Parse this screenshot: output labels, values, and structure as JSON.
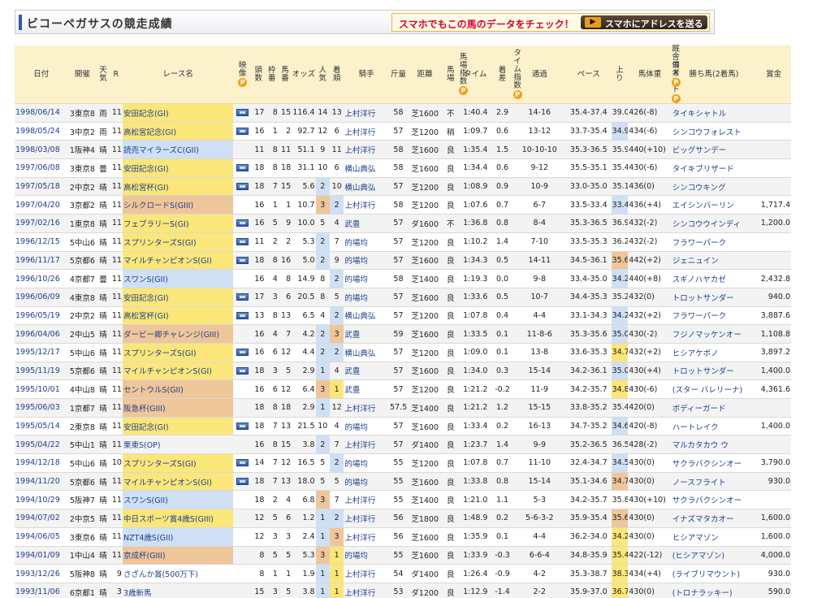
{
  "header": {
    "title": "ビコーペガサスの競走成績",
    "promo_text": "スマホでもこの馬のデータをチェック！",
    "promo_button": "スマホにアドレスを送る",
    "promo_icon_text": "▶"
  },
  "columns": [
    "日付",
    "開催",
    "天気",
    "R",
    "レース名",
    "映像",
    "頭数",
    "枠番",
    "馬番",
    "オッズ",
    "人気",
    "着順",
    "騎手",
    "斤量",
    "距離",
    "馬場",
    "馬場指数",
    "タイム",
    "着差",
    "タイム指数",
    "通過",
    "ペース",
    "上り",
    "馬体重",
    "厩舎コメント",
    "備考",
    "勝ち馬(2着馬)",
    "賞金"
  ],
  "rows": [
    {
      "date": "1998/06/14",
      "venue": "3東京8",
      "weather": "雨",
      "r": "11",
      "race": "安田記念(GI)",
      "race_color": "y",
      "video": true,
      "heads": "17",
      "waku": "8",
      "umaban": "15",
      "odds": "116.4",
      "ninki": "14",
      "rank": "13",
      "jockey": "上村洋行",
      "kin": "58",
      "dist": "芝1600",
      "baba": "不",
      "time": "1:40.4",
      "diff": "2.9",
      "pass": "14-16",
      "pace": "35.4-37.4",
      "agari": "39.0",
      "agari_hl": "",
      "weight": "426(-8)",
      "winner": "タイキシャトル",
      "prize": ""
    },
    {
      "date": "1998/05/24",
      "venue": "3中京2",
      "weather": "雨",
      "r": "11",
      "race": "高松宮記念(GI)",
      "race_color": "y",
      "video": true,
      "heads": "16",
      "waku": "1",
      "umaban": "2",
      "odds": "92.7",
      "ninki": "12",
      "rank": "6",
      "jockey": "上村洋行",
      "kin": "57",
      "dist": "芝1200",
      "baba": "稍",
      "time": "1:09.7",
      "diff": "0.6",
      "pass": "13-12",
      "pace": "33.7-35.4",
      "agari": "34.9",
      "agari_hl": "b",
      "weight": "434(-6)",
      "winner": "シンコウフォレスト",
      "prize": ""
    },
    {
      "date": "1998/03/08",
      "venue": "1阪神4",
      "weather": "晴",
      "r": "11",
      "race": "読売マイラーズC(GII)",
      "race_color": "b",
      "video": false,
      "heads": "11",
      "waku": "8",
      "umaban": "11",
      "odds": "51.1",
      "ninki": "9",
      "rank": "11",
      "jockey": "上村洋行",
      "kin": "58",
      "dist": "芝1600",
      "baba": "良",
      "time": "1:35.4",
      "diff": "1.5",
      "pass": "10-10-10",
      "pace": "35.3-36.5",
      "agari": "35.9",
      "agari_hl": "",
      "weight": "440(+10)",
      "winner": "ビッグサンデー",
      "prize": ""
    },
    {
      "date": "1997/06/08",
      "venue": "3東京8",
      "weather": "曇",
      "r": "11",
      "race": "安田記念(GI)",
      "race_color": "y",
      "video": true,
      "heads": "18",
      "waku": "8",
      "umaban": "18",
      "odds": "31.1",
      "ninki": "10",
      "rank": "6",
      "jockey": "横山典弘",
      "kin": "58",
      "dist": "芝1600",
      "baba": "良",
      "time": "1:34.4",
      "diff": "0.6",
      "pass": "9-12",
      "pace": "35.5-35.1",
      "agari": "35.4",
      "agari_hl": "",
      "weight": "430(-6)",
      "winner": "タイキブリザード",
      "prize": ""
    },
    {
      "date": "1997/05/18",
      "venue": "2中京2",
      "weather": "晴",
      "r": "11",
      "race": "高松宮杯(GI)",
      "race_color": "y",
      "video": true,
      "heads": "18",
      "waku": "7",
      "umaban": "15",
      "odds": "5.6",
      "ninki": "2",
      "ninki_hl": "b",
      "rank": "10",
      "jockey": "横山典弘",
      "kin": "57",
      "dist": "芝1200",
      "baba": "良",
      "time": "1:08.9",
      "diff": "0.9",
      "pass": "10-9",
      "pace": "33.0-35.0",
      "agari": "35.1",
      "agari_hl": "",
      "weight": "436(0)",
      "winner": "シンコウキング",
      "prize": ""
    },
    {
      "date": "1997/04/20",
      "venue": "3京都2",
      "weather": "晴",
      "r": "11",
      "race": "シルクロードS(GIII)",
      "race_color": "o",
      "video": false,
      "heads": "16",
      "waku": "1",
      "umaban": "1",
      "odds": "10.7",
      "ninki": "3",
      "ninki_hl": "o",
      "rank": "2",
      "rank_hl": "b",
      "jockey": "上村洋行",
      "kin": "58",
      "dist": "芝1200",
      "baba": "良",
      "time": "1:07.6",
      "diff": "0.7",
      "pass": "6-7",
      "pace": "33.5-33.4",
      "agari": "33.4",
      "agari_hl": "b",
      "weight": "436(+4)",
      "winner": "エイシンバーリン",
      "prize": "1,717.4"
    },
    {
      "date": "1997/02/16",
      "venue": "1東京8",
      "weather": "晴",
      "r": "11",
      "race": "フェブラリーS(GI)",
      "race_color": "y",
      "video": true,
      "heads": "16",
      "waku": "5",
      "umaban": "9",
      "odds": "10.0",
      "ninki": "5",
      "rank": "4",
      "jockey": "武豊",
      "kin": "57",
      "dist": "ダ1600",
      "baba": "不",
      "time": "1:36.8",
      "diff": "0.8",
      "pass": "8-4",
      "pace": "35.3-36.5",
      "agari": "36.9",
      "agari_hl": "",
      "weight": "432(-2)",
      "winner": "シンコウウインディ",
      "prize": "1,200.0"
    },
    {
      "date": "1996/12/15",
      "venue": "5中山6",
      "weather": "晴",
      "r": "11",
      "race": "スプリンターズS(GI)",
      "race_color": "y",
      "video": true,
      "heads": "11",
      "waku": "2",
      "umaban": "2",
      "odds": "5.3",
      "ninki": "2",
      "ninki_hl": "b",
      "rank": "7",
      "jockey": "的場均",
      "kin": "57",
      "dist": "芝1200",
      "baba": "良",
      "time": "1:10.2",
      "diff": "1.4",
      "pass": "7-10",
      "pace": "33.5-35.3",
      "agari": "36.2",
      "agari_hl": "",
      "weight": "432(-2)",
      "winner": "フラワーパーク",
      "prize": ""
    },
    {
      "date": "1996/11/17",
      "venue": "5京都6",
      "weather": "晴",
      "r": "11",
      "race": "マイルチャンピオンS(GI)",
      "race_color": "y",
      "video": true,
      "heads": "18",
      "waku": "8",
      "umaban": "16",
      "odds": "5.0",
      "ninki": "2",
      "ninki_hl": "b",
      "rank": "9",
      "jockey": "的場均",
      "kin": "57",
      "dist": "芝1600",
      "baba": "良",
      "time": "1:34.3",
      "diff": "0.5",
      "pass": "14-11",
      "pace": "34.5-36.1",
      "agari": "35.6",
      "agari_hl": "o",
      "weight": "442(+2)",
      "winner": "ジェニュイン",
      "prize": ""
    },
    {
      "date": "1996/10/26",
      "venue": "4京都7",
      "weather": "曇",
      "r": "11",
      "race": "スワンS(GII)",
      "race_color": "b",
      "video": false,
      "heads": "16",
      "waku": "4",
      "umaban": "8",
      "odds": "14.9",
      "ninki": "8",
      "rank": "2",
      "rank_hl": "b",
      "jockey": "的場均",
      "kin": "58",
      "dist": "芝1400",
      "baba": "良",
      "time": "1:19.3",
      "diff": "0.0",
      "pass": "9-8",
      "pace": "33.4-35.0",
      "agari": "34.2",
      "agari_hl": "b",
      "weight": "440(+8)",
      "winner": "スギノハヤカゼ",
      "prize": "2,432.8"
    },
    {
      "date": "1996/06/09",
      "venue": "4東京8",
      "weather": "晴",
      "r": "11",
      "race": "安田記念(GI)",
      "race_color": "y",
      "video": true,
      "heads": "17",
      "waku": "3",
      "umaban": "6",
      "odds": "20.5",
      "ninki": "8",
      "rank": "5",
      "jockey": "的場均",
      "kin": "57",
      "dist": "芝1600",
      "baba": "良",
      "time": "1:33.6",
      "diff": "0.5",
      "pass": "10-7",
      "pace": "34.4-35.3",
      "agari": "35.2",
      "agari_hl": "",
      "weight": "432(0)",
      "winner": "トロットサンダー",
      "prize": "940.0"
    },
    {
      "date": "1996/05/19",
      "venue": "2中京2",
      "weather": "晴",
      "r": "11",
      "race": "高松宮杯(GI)",
      "race_color": "y",
      "video": true,
      "heads": "13",
      "waku": "8",
      "umaban": "13",
      "odds": "6.5",
      "ninki": "4",
      "rank": "2",
      "rank_hl": "b",
      "jockey": "横山典弘",
      "kin": "57",
      "dist": "芝1200",
      "baba": "良",
      "time": "1:07.8",
      "diff": "0.4",
      "pass": "4-4",
      "pace": "33.1-34.3",
      "agari": "34.2",
      "agari_hl": "b",
      "weight": "432(+2)",
      "winner": "フラワーパーク",
      "prize": "3,887.6"
    },
    {
      "date": "1996/04/06",
      "venue": "2中山5",
      "weather": "晴",
      "r": "11",
      "race": "ダービー卿チャレンジ(GIII)",
      "race_color": "o",
      "video": false,
      "heads": "16",
      "waku": "4",
      "umaban": "7",
      "odds": "4.2",
      "ninki": "2",
      "ninki_hl": "b",
      "rank": "3",
      "rank_hl": "o",
      "jockey": "武豊",
      "kin": "59",
      "dist": "芝1600",
      "baba": "良",
      "time": "1:33.5",
      "diff": "0.1",
      "pass": "11-8-6",
      "pace": "35.3-35.6",
      "agari": "35.0",
      "agari_hl": "b",
      "weight": "430(-2)",
      "winner": "フジノマッケンオー",
      "prize": "1,108.8"
    },
    {
      "date": "1995/12/17",
      "venue": "5中山6",
      "weather": "晴",
      "r": "11",
      "race": "スプリンターズS(GI)",
      "race_color": "y",
      "video": true,
      "heads": "16",
      "waku": "6",
      "umaban": "12",
      "odds": "4.4",
      "ninki": "2",
      "ninki_hl": "b",
      "rank": "2",
      "rank_hl": "b",
      "jockey": "横山典弘",
      "kin": "57",
      "dist": "芝1200",
      "baba": "良",
      "time": "1:09.0",
      "diff": "0.1",
      "pass": "13-8",
      "pace": "33.6-35.3",
      "agari": "34.7",
      "agari_hl": "y",
      "weight": "432(+2)",
      "winner": "ヒシアケボノ",
      "prize": "3,897.2"
    },
    {
      "date": "1995/11/19",
      "venue": "5京都6",
      "weather": "晴",
      "r": "11",
      "race": "マイルチャンピオンS(GI)",
      "race_color": "y",
      "video": true,
      "heads": "18",
      "waku": "3",
      "umaban": "5",
      "odds": "2.9",
      "ninki": "1",
      "ninki_hl": "b",
      "rank": "4",
      "jockey": "武豊",
      "kin": "57",
      "dist": "芝1600",
      "baba": "良",
      "time": "1:34.0",
      "diff": "0.3",
      "pass": "15-14",
      "pace": "34.2-36.1",
      "agari": "35.0",
      "agari_hl": "b",
      "weight": "430(+4)",
      "winner": "トロットサンダー",
      "prize": "1,400.0"
    },
    {
      "date": "1995/10/01",
      "venue": "4中山8",
      "weather": "晴",
      "r": "11",
      "race": "セントウルS(GII)",
      "race_color": "o",
      "video": false,
      "heads": "16",
      "waku": "6",
      "umaban": "12",
      "odds": "6.4",
      "ninki": "3",
      "ninki_hl": "o",
      "rank": "1",
      "rank_hl": "y",
      "jockey": "武豊",
      "kin": "57",
      "dist": "芝1200",
      "baba": "良",
      "time": "1:21.2",
      "diff": "-0.2",
      "pass": "11-9",
      "pace": "34.2-35.7",
      "agari": "34.8",
      "agari_hl": "y",
      "weight": "430(-6)",
      "winner": "(スター バレリーナ)",
      "prize": "4,361.6"
    },
    {
      "date": "1995/06/03",
      "venue": "1京都7",
      "weather": "晴",
      "r": "11",
      "race": "阪急杯(GIII)",
      "race_color": "o",
      "video": false,
      "heads": "18",
      "waku": "8",
      "umaban": "18",
      "odds": "2.9",
      "ninki": "1",
      "ninki_hl": "b",
      "rank": "12",
      "jockey": "上村洋行",
      "kin": "57.5",
      "dist": "芝1400",
      "baba": "良",
      "time": "1:21.2",
      "diff": "1.2",
      "pass": "15-15",
      "pace": "33.8-35.2",
      "agari": "35.4",
      "agari_hl": "",
      "weight": "420(0)",
      "winner": "ボディーガード",
      "prize": ""
    },
    {
      "date": "1995/05/14",
      "venue": "2東京8",
      "weather": "晴",
      "r": "11",
      "race": "安田記念(GI)",
      "race_color": "y",
      "video": true,
      "heads": "18",
      "waku": "7",
      "umaban": "13",
      "odds": "21.5",
      "ninki": "10",
      "rank": "4",
      "jockey": "的場均",
      "kin": "57",
      "dist": "芝1600",
      "baba": "良",
      "time": "1:33.4",
      "diff": "0.2",
      "pass": "16-13",
      "pace": "34.7-35.2",
      "agari": "34.6",
      "agari_hl": "b",
      "weight": "420(-8)",
      "winner": "ハートレイク",
      "prize": "1,400.0"
    },
    {
      "date": "1995/04/22",
      "venue": "5中山1",
      "weather": "晴",
      "r": "11",
      "race": "栗東S(OP)",
      "race_color": "",
      "video": false,
      "heads": "16",
      "waku": "8",
      "umaban": "15",
      "odds": "3.8",
      "ninki": "2",
      "ninki_hl": "b",
      "rank": "7",
      "jockey": "上村洋行",
      "kin": "57",
      "dist": "ダ1400",
      "baba": "良",
      "time": "1:23.7",
      "diff": "1.4",
      "pass": "9-9",
      "pace": "35.2-36.5",
      "agari": "36.5",
      "agari_hl": "",
      "weight": "428(-2)",
      "winner": "マルカタカウ ウ",
      "prize": ""
    },
    {
      "date": "1994/12/18",
      "venue": "5中山6",
      "weather": "晴",
      "r": "10",
      "race": "スプリンターズS(GI)",
      "race_color": "y",
      "video": true,
      "heads": "14",
      "waku": "7",
      "umaban": "12",
      "odds": "16.5",
      "ninki": "5",
      "rank": "2",
      "rank_hl": "b",
      "jockey": "的場均",
      "kin": "55",
      "dist": "芝1200",
      "baba": "良",
      "time": "1:07.8",
      "diff": "0.7",
      "pass": "11-10",
      "pace": "32.4-34.7",
      "agari": "34.5",
      "agari_hl": "b",
      "weight": "430(0)",
      "winner": "サクラバクシンオー",
      "prize": "3,790.0"
    },
    {
      "date": "1994/11/20",
      "venue": "5京都6",
      "weather": "晴",
      "r": "11",
      "race": "マイルチャンピオンS(GI)",
      "race_color": "y",
      "video": true,
      "heads": "18",
      "waku": "7",
      "umaban": "13",
      "odds": "18.0",
      "ninki": "5",
      "rank": "5",
      "jockey": "的場均",
      "kin": "55",
      "dist": "芝1600",
      "baba": "良",
      "time": "1:33.8",
      "diff": "0.8",
      "pass": "15-14",
      "pace": "35.1-34.6",
      "agari": "34.7",
      "agari_hl": "o",
      "weight": "430(0)",
      "winner": "ノースフライト",
      "prize": "930.0"
    },
    {
      "date": "1994/10/29",
      "venue": "5阪神7",
      "weather": "晴",
      "r": "11",
      "race": "スワンS(GII)",
      "race_color": "b",
      "video": false,
      "heads": "18",
      "waku": "2",
      "umaban": "4",
      "odds": "6.8",
      "ninki": "3",
      "ninki_hl": "o",
      "rank": "7",
      "jockey": "上村洋行",
      "kin": "55",
      "dist": "芝1400",
      "baba": "良",
      "time": "1:21.0",
      "diff": "1.1",
      "pass": "5-3",
      "pace": "34.2-35.7",
      "agari": "35.8",
      "agari_hl": "",
      "weight": "430(+10)",
      "winner": "サクラバクシンオー",
      "prize": ""
    },
    {
      "date": "1994/07/02",
      "venue": "2中京5",
      "weather": "晴",
      "r": "11",
      "race": "中日スポーツ賞4歳S(GIII)",
      "race_color": "y",
      "video": false,
      "heads": "12",
      "waku": "5",
      "umaban": "6",
      "odds": "1.2",
      "ninki": "1",
      "ninki_hl": "b",
      "rank": "2",
      "rank_hl": "b",
      "jockey": "上村洋行",
      "kin": "56",
      "dist": "芝1800",
      "baba": "良",
      "time": "1:48.9",
      "diff": "0.2",
      "pass": "5-6-3-2",
      "pace": "35.9-35.4",
      "agari": "35.6",
      "agari_hl": "o",
      "weight": "430(0)",
      "winner": "イナズマタカオー",
      "prize": "1,600.0"
    },
    {
      "date": "1994/06/05",
      "venue": "3東京6",
      "weather": "晴",
      "r": "11",
      "race": "NZT4歳S(GII)",
      "race_color": "b",
      "video": false,
      "heads": "12",
      "waku": "3",
      "umaban": "3",
      "odds": "2.4",
      "ninki": "1",
      "ninki_hl": "b",
      "rank": "3",
      "rank_hl": "o",
      "jockey": "上村洋行",
      "kin": "56",
      "dist": "芝1600",
      "baba": "良",
      "time": "1:35.9",
      "diff": "0.1",
      "pass": "4-4",
      "pace": "36.2-34.0",
      "agari": "34.2",
      "agari_hl": "y",
      "weight": "430(0)",
      "winner": "ヒシアマゾン",
      "prize": "1,600.0"
    },
    {
      "date": "1994/01/09",
      "venue": "1中山4",
      "weather": "晴",
      "r": "11",
      "race": "京成杯(GIII)",
      "race_color": "o",
      "video": false,
      "heads": "8",
      "waku": "5",
      "umaban": "5",
      "odds": "5.3",
      "ninki": "3",
      "ninki_hl": "o",
      "rank": "1",
      "rank_hl": "y",
      "jockey": "的場均",
      "kin": "55",
      "dist": "芝1600",
      "baba": "良",
      "time": "1:33.9",
      "diff": "-0.3",
      "pass": "6-6-4",
      "pace": "34.8-35.9",
      "agari": "35.4",
      "agari_hl": "y",
      "weight": "422(-12)",
      "winner": "(ヒシアマゾン)",
      "prize": "4,000.0"
    },
    {
      "date": "1993/12/26",
      "venue": "5阪神8",
      "weather": "晴",
      "r": "9",
      "race": "さざんか賞(500万下)",
      "race_color": "",
      "video": false,
      "heads": "8",
      "waku": "1",
      "umaban": "1",
      "odds": "1.9",
      "ninki": "1",
      "ninki_hl": "b",
      "rank": "1",
      "rank_hl": "y",
      "jockey": "上村洋行",
      "kin": "54",
      "dist": "ダ1400",
      "baba": "良",
      "time": "1:26.4",
      "diff": "-0.9",
      "pass": "4-2",
      "pace": "35.3-38.7",
      "agari": "38.3",
      "agari_hl": "y",
      "weight": "434(+4)",
      "winner": "(ライブリマウント)",
      "prize": "930.0"
    },
    {
      "date": "1993/11/06",
      "venue": "6京都1",
      "weather": "晴",
      "r": "3",
      "race": "3歳新馬",
      "race_color": "",
      "video": false,
      "heads": "15",
      "waku": "3",
      "umaban": "5",
      "odds": "3.8",
      "ninki": "1",
      "ninki_hl": "b",
      "rank": "1",
      "rank_hl": "y",
      "jockey": "上村洋行",
      "kin": "53",
      "dist": "ダ1200",
      "baba": "良",
      "time": "1:12.9",
      "diff": "-1.4",
      "pass": "2-2",
      "pace": "35.9-37.0",
      "agari": "36.7",
      "agari_hl": "y",
      "weight": "430(0)",
      "winner": "(トロナラッキー)",
      "prize": "590.0"
    }
  ]
}
